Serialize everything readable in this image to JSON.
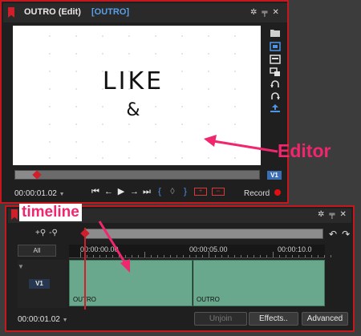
{
  "editor": {
    "title": "OUTRO (Edit)",
    "tag": "[OUTRO]",
    "window_icons": [
      "settings-icon",
      "pin-icon",
      "close-icon"
    ],
    "preview": {
      "line1": "LIKE",
      "line2": "&"
    },
    "side_tools": [
      "folder-icon",
      "safe-area-icon",
      "fit-icon",
      "crop-icon",
      "rotate-left-icon",
      "rotate-right-icon",
      "export-icon"
    ],
    "scrubber_progress": 0.09,
    "track_badge": "V1",
    "timecode": "00:00:01.02",
    "transport": [
      "skip-start-icon",
      "step-back-icon",
      "play-icon",
      "step-forward-icon",
      "skip-end-icon",
      "mark-in-icon",
      "mark-icon",
      "mark-out-icon",
      "insert-icon",
      "overwrite-icon"
    ],
    "record_label": "Record"
  },
  "timeline": {
    "window_icons": [
      "settings-icon",
      "pin-icon",
      "close-icon"
    ],
    "all_label": "All",
    "ruler_labels": [
      "00:00:00.00",
      "00:00:05.00",
      "00:00:10.0"
    ],
    "track_label": "V1",
    "clips": [
      {
        "label": "OUTRO"
      },
      {
        "label": "OUTRO"
      }
    ],
    "timecode": "00:00:01.02",
    "buttons": {
      "unjoin": "Unjoin",
      "effects": "Effects..",
      "advanced": "Advanced"
    }
  },
  "annotations": {
    "editor_label": "Editor",
    "timeline_label": "timeline",
    "color": "#f0266e"
  },
  "colors": {
    "accent_red": "#c4181f",
    "clip_green": "#6aa88d",
    "tag_blue": "#5a9fe8"
  }
}
